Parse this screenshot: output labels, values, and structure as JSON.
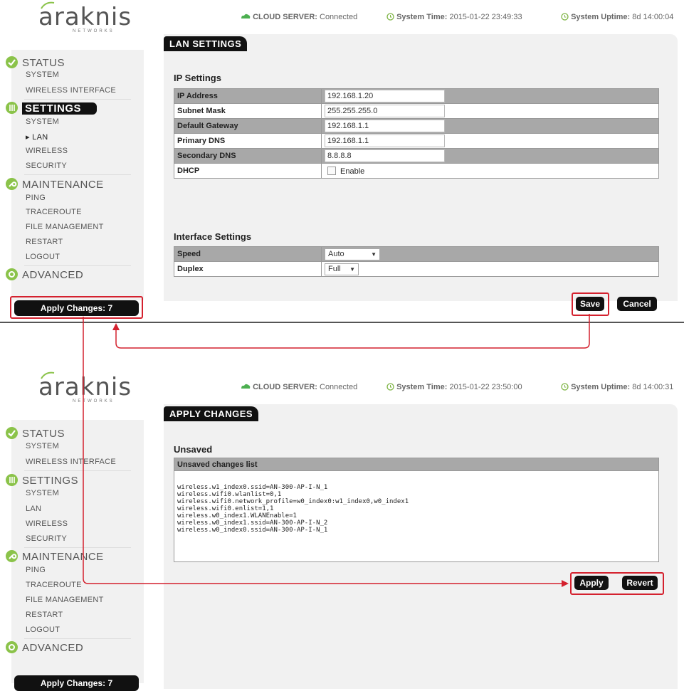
{
  "logo": {
    "word": "araknis",
    "sub": "NETWORKS"
  },
  "colors": {
    "accent_green": "#8bc34a",
    "annotation_red": "#d4212e",
    "dark": "#111111",
    "panel_bg": "#f1f1f1"
  },
  "screens": [
    {
      "topbar": {
        "cloud_label": "CLOUD SERVER:",
        "cloud_value": "Connected",
        "time_label": "System Time:",
        "time_value": "2015-01-22 23:49:33",
        "uptime_label": "System Uptime:",
        "uptime_value": "8d 14:00:04"
      },
      "page_tab": "LAN SETTINGS",
      "sidebar": {
        "status": "STATUS",
        "status_items": [
          "SYSTEM",
          "WIRELESS INTERFACE"
        ],
        "settings": "SETTINGS",
        "settings_items": [
          "SYSTEM",
          "▸ LAN",
          "WIRELESS",
          "SECURITY"
        ],
        "maintenance": "MAINTENANCE",
        "maintenance_items": [
          "PING",
          "TRACEROUTE",
          "FILE MANAGEMENT",
          "RESTART",
          "LOGOUT"
        ],
        "advanced": "ADVANCED",
        "apply_changes": "Apply Changes: 7"
      },
      "ip_settings": {
        "title": "IP Settings",
        "rows": [
          {
            "label": "IP Address",
            "value": "192.168.1.20"
          },
          {
            "label": "Subnet Mask",
            "value": "255.255.255.0"
          },
          {
            "label": "Default Gateway",
            "value": "192.168.1.1"
          },
          {
            "label": "Primary DNS",
            "value": "192.168.1.1"
          },
          {
            "label": "Secondary DNS",
            "value": "8.8.8.8"
          },
          {
            "label": "DHCP",
            "value": "Enable",
            "checked": false
          }
        ]
      },
      "interface_settings": {
        "title": "Interface Settings",
        "rows": [
          {
            "label": "Speed",
            "value": "Auto"
          },
          {
            "label": "Duplex",
            "value": "Full"
          }
        ]
      },
      "buttons": {
        "save": "Save",
        "cancel": "Cancel"
      }
    },
    {
      "topbar": {
        "cloud_label": "CLOUD SERVER:",
        "cloud_value": "Connected",
        "time_label": "System Time:",
        "time_value": "2015-01-22 23:50:00",
        "uptime_label": "System Uptime:",
        "uptime_value": "8d 14:00:31"
      },
      "page_tab": "APPLY CHANGES",
      "sidebar": {
        "status": "STATUS",
        "status_items": [
          "SYSTEM",
          "WIRELESS INTERFACE"
        ],
        "settings": "SETTINGS",
        "settings_items": [
          "SYSTEM",
          "LAN",
          "WIRELESS",
          "SECURITY"
        ],
        "maintenance": "MAINTENANCE",
        "maintenance_items": [
          "PING",
          "TRACEROUTE",
          "FILE MANAGEMENT",
          "RESTART",
          "LOGOUT"
        ],
        "advanced": "ADVANCED",
        "apply_changes": "Apply Changes: 7"
      },
      "unsaved": {
        "title": "Unsaved",
        "list_header": "Unsaved changes list",
        "lines": [
          "wireless.w1_index0.ssid=AN-300-AP-I-N_1",
          "wireless.wifi0.wlanlist=0,1",
          "wireless.wifi0.network_profile=w0_index0:w1_index0,w0_index1",
          "wireless.wifi0.enlist=1,1",
          "wireless.w0_index1.WLANEnable=1",
          "wireless.w0_index1.ssid=AN-300-AP-I-N_2",
          "wireless.w0_index0.ssid=AN-300-AP-I-N_1"
        ]
      },
      "buttons": {
        "apply": "Apply",
        "revert": "Revert"
      }
    }
  ]
}
